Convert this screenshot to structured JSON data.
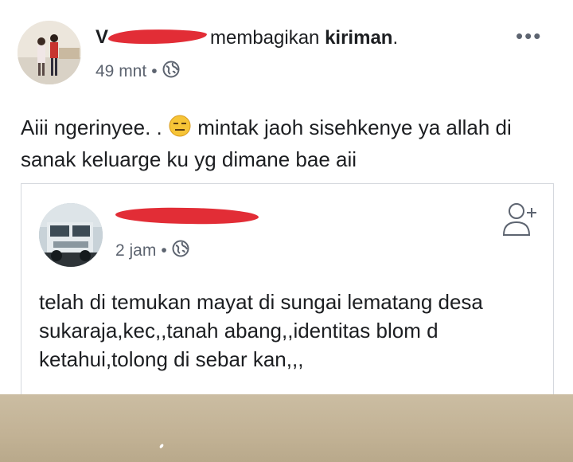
{
  "post": {
    "author_initial": "V",
    "action_text": "membagikan ",
    "action_object": "kiriman",
    "action_end": ".",
    "time": "49 mnt",
    "separator": "•",
    "more_label": "•••",
    "text_before_emoji": "Aiii ngerinyee.  . ",
    "emoji": "expressionless-face",
    "text_after_emoji": " mintak jaoh sisehkenye ya allah di sanak keluarge ku yg dimane bae aii"
  },
  "shared_post": {
    "time": "2 jam",
    "separator": "•",
    "text": "telah di temukan mayat di sungai lematang desa sukaraja,kec,,tanah abang,,identitas blom d ketahui,tolong di sebar kan,,,"
  },
  "icons": {
    "privacy": "globe-icon",
    "add_friend": "add-friend-icon",
    "more": "more-options-icon"
  },
  "colors": {
    "redaction": "#e22d36",
    "meta_text": "#5d6470",
    "body_text": "#1c1e21"
  }
}
